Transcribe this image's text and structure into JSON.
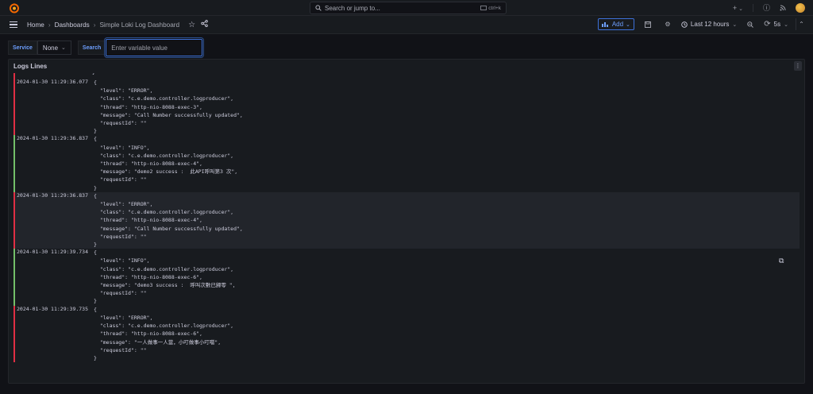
{
  "topbar": {
    "search_placeholder": "Search or jump to...",
    "search_shortcut": "ctrl+k",
    "plus_label": "+",
    "help_icon": "help-icon",
    "news_icon": "rss-icon"
  },
  "navbar": {
    "breadcrumbs": [
      "Home",
      "Dashboards",
      "Simple Loki Log Dashboard"
    ],
    "add_label": "Add",
    "time_range": "Last 12 hours",
    "refresh_interval": "5s"
  },
  "variables": {
    "service_label": "Service",
    "service_value": "None",
    "search_label": "Search",
    "search_placeholder": "Enter variable value"
  },
  "panel": {
    "title": "Logs Lines",
    "partial_line": "}",
    "logs": [
      {
        "level_color": "#e02f44",
        "timestamp": "2024-01-30 11:29:36.077",
        "body": "{\n  \"level\": \"ERROR\",\n  \"class\": \"c.e.demo.controller.logproducer\",\n  \"thread\": \"http-nio-8088-exec-3\",\n  \"message\": \"Call Number successfully updated\",\n  \"requestId\": \"\"\n}"
      },
      {
        "level_color": "#73bf69",
        "timestamp": "2024-01-30 11:29:36.837",
        "body": "{\n  \"level\": \"INFO\",\n  \"class\": \"c.e.demo.controller.logproducer\",\n  \"thread\": \"http-nio-8088-exec-4\",\n  \"message\": \"demo2 success :  此API呼叫第3 次\",\n  \"requestId\": \"\"\n}"
      },
      {
        "level_color": "#e02f44",
        "timestamp": "2024-01-30 11:29:36.837",
        "body": "{\n  \"level\": \"ERROR\",\n  \"class\": \"c.e.demo.controller.logproducer\",\n  \"thread\": \"http-nio-8088-exec-4\",\n  \"message\": \"Call Number successfully updated\",\n  \"requestId\": \"\"\n}"
      },
      {
        "level_color": "#73bf69",
        "timestamp": "2024-01-30 11:29:39.734",
        "body": "{\n  \"level\": \"INFO\",\n  \"class\": \"c.e.demo.controller.logproducer\",\n  \"thread\": \"http-nio-8088-exec-6\",\n  \"message\": \"demo3 success :  呼叫次數已歸零 \",\n  \"requestId\": \"\"\n}"
      },
      {
        "level_color": "#e02f44",
        "timestamp": "2024-01-30 11:29:39.735",
        "body": "{\n  \"level\": \"ERROR\",\n  \"class\": \"c.e.demo.controller.logproducer\",\n  \"thread\": \"http-nio-8088-exec-6\",\n  \"message\": \"一人做事一人當，小叮做事小叮噹\",\n  \"requestId\": \"\"\n}"
      }
    ]
  }
}
